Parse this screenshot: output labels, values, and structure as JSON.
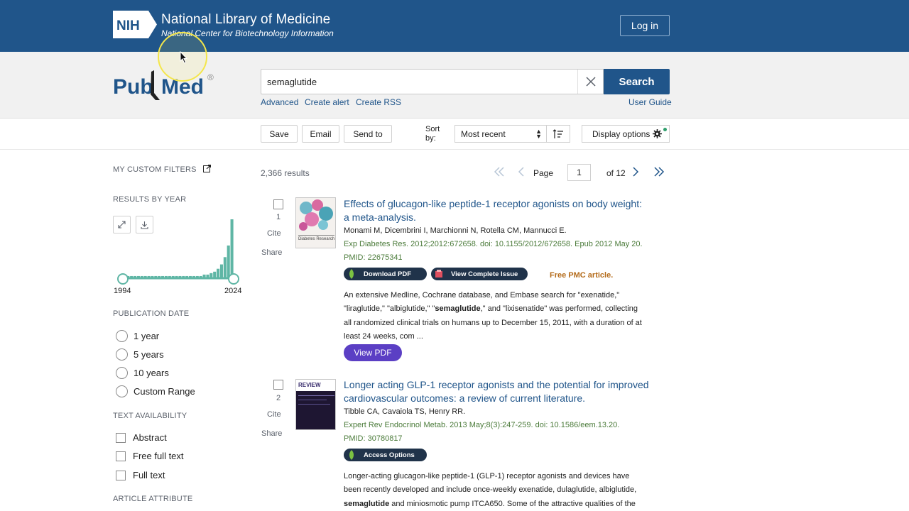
{
  "header": {
    "nih_badge": "NIH",
    "title": "National Library of Medicine",
    "subtitle": "National Center for Biotechnology Information",
    "login_label": "Log in"
  },
  "search": {
    "logo_text_pub": "Pub",
    "logo_text_med": "Med",
    "logo_reg": "®",
    "query": "semaglutide",
    "button_label": "Search",
    "links": [
      "Advanced",
      "Create alert",
      "Create RSS"
    ],
    "user_guide": "User Guide"
  },
  "toolbar": {
    "save_label": "Save",
    "email_label": "Email",
    "sendto_label": "Send to",
    "sortby_line1": "Sort",
    "sortby_line2": "by:",
    "sort_value": "Most recent",
    "display_label": "Display options"
  },
  "sidebar": {
    "custom_filters": "MY CUSTOM FILTERS",
    "results_by_year": "RESULTS BY YEAR",
    "year_start": "1994",
    "year_end": "2024",
    "histogram_bars": [
      1,
      1,
      1,
      1,
      1,
      1,
      1,
      1,
      1,
      1,
      1,
      1,
      1,
      1,
      1,
      1,
      1,
      1,
      1,
      1,
      1,
      1,
      1,
      2,
      2,
      3,
      4,
      6,
      9,
      14,
      22,
      40
    ],
    "publication_date": "PUBLICATION DATE",
    "date_options": [
      "1 year",
      "5 years",
      "10 years",
      "Custom Range"
    ],
    "text_availability": "TEXT AVAILABILITY",
    "text_options": [
      "Abstract",
      "Free full text",
      "Full text"
    ],
    "article_attribute": "ARTICLE ATTRIBUTE"
  },
  "pagination": {
    "results": "2,366 results",
    "page_label": "Page",
    "page_value": "1",
    "of_label": "of 12"
  },
  "results": [
    {
      "num": "1",
      "cite": "Cite",
      "share": "Share",
      "title_line1": "Effects of glucagon-like peptide-1 receptor agonists on body weight:",
      "title_line2": "a meta-analysis.",
      "authors": "Monami M, Dicembrini I, Marchionni N, Rotella CM, Mannucci E.",
      "citation": "Exp Diabetes Res. 2012;2012:672658. doi: 10.1155/2012/672658. Epub 2012 May 20.",
      "pmid": "PMID: 22675341",
      "pill1": "Download PDF",
      "pill2": "View Complete Issue",
      "free": "Free PMC article.",
      "thumb_text": "Diabetes Research",
      "abstract_l1": "An extensive Medline, Cochrane database, and Embase search for \"exenatide,\"",
      "abstract_l2a": "\"liraglutide,\" \"albiglutide,\" \"",
      "abstract_l2b": "semaglutide",
      "abstract_l2c": ",\" and \"lixisenatide\" was performed, collecting",
      "abstract_l3": "all randomized clinical trials on humans up to December 15, 2011, with a duration of at",
      "abstract_l4": "least 24 weeks, com ...",
      "view_pdf": "View PDF"
    },
    {
      "num": "2",
      "cite": "Cite",
      "share": "Share",
      "title_line1": "Longer acting GLP-1 receptor agonists and the potential for improved",
      "title_line2": "cardiovascular outcomes: a review of current literature.",
      "authors": "Tibble CA, Cavaiola TS, Henry RR.",
      "citation": "Expert Rev Endocrinol Metab. 2013 May;8(3):247-259. doi: 10.1586/eem.13.20.",
      "pmid": "PMID: 30780817",
      "pill1": "Access Options",
      "thumb_text": "REVIEW",
      "abstract_l1": "Longer-acting glucagon-like peptide-1 (GLP-1) receptor agonists and devices have",
      "abstract_l2": "been recently developed and include once-weekly exenatide, dulaglutide, albiglutide,",
      "abstract_l3a": "semaglutide",
      "abstract_l3b": " and miniosmotic pump ITCA650. Some of the attractive qualities of the"
    }
  ],
  "colors": {
    "brand_blue": "#20558a",
    "pill_dark": "#20334a",
    "view_pdf_purple": "#5b3fc4",
    "free_pmc_orange": "#b46b1a",
    "citation_green": "#4b7b3a"
  }
}
